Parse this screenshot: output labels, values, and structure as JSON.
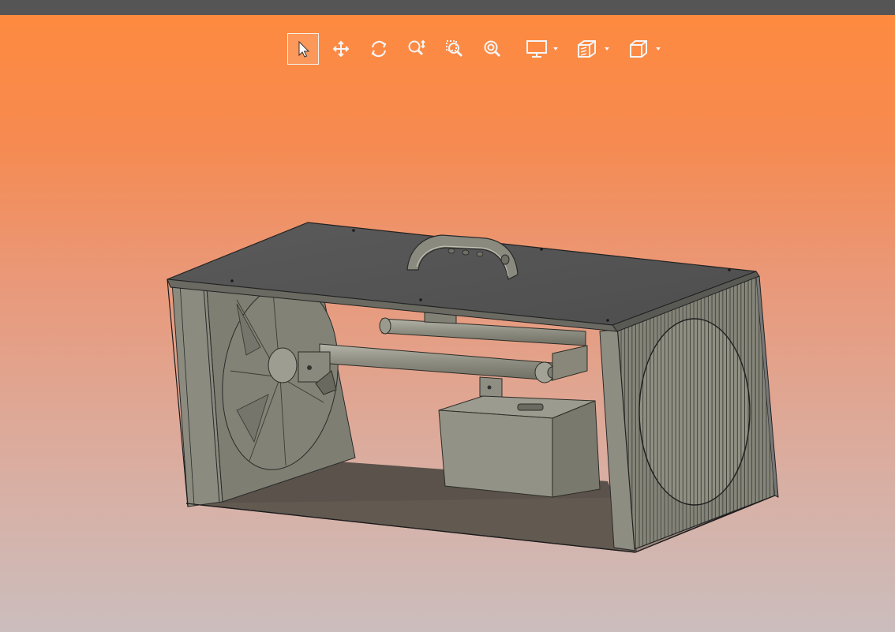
{
  "toolbar": {
    "tools": [
      {
        "id": "select",
        "icon": "select-arrow-icon",
        "active": true
      },
      {
        "id": "pan",
        "icon": "pan-move-icon",
        "active": false
      },
      {
        "id": "rotate",
        "icon": "rotate-icon",
        "active": false
      },
      {
        "id": "zoom-in-out",
        "icon": "zoom-in-out-icon",
        "active": false
      },
      {
        "id": "zoom-window",
        "icon": "zoom-window-icon",
        "active": false
      },
      {
        "id": "zoom-fit",
        "icon": "zoom-fit-icon",
        "active": false
      },
      {
        "id": "display-mode",
        "icon": "monitor-icon",
        "has_dropdown": true
      },
      {
        "id": "section-view",
        "icon": "section-view-icon",
        "has_dropdown": true
      },
      {
        "id": "standard-views",
        "icon": "cube-view-icon",
        "has_dropdown": true
      }
    ]
  },
  "viewport": {
    "background_top": "#ff8a3d",
    "background_bottom": "#cbbdbd",
    "model": "box-enclosure-with-handle"
  },
  "colors": {
    "titlebar": "#555555",
    "model_panel_dark": "#575757",
    "model_part_gray": "#8e8e80",
    "icon_white": "#f5f5f5"
  }
}
